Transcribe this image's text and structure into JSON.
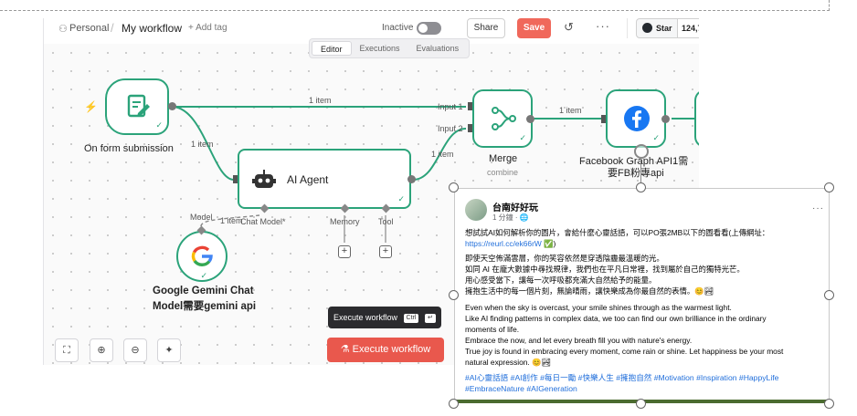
{
  "header": {
    "personal": "Personal",
    "sep": "/",
    "title": "My workflow",
    "add_tag": "+ Add tag",
    "inactive": "Inactive",
    "share": "Share",
    "save": "Save",
    "github_star": "Star",
    "github_count": "124,7"
  },
  "tabs": [
    {
      "label": "Editor",
      "active": true
    },
    {
      "label": "Executions",
      "active": false
    },
    {
      "label": "Evaluations",
      "active": false
    }
  ],
  "nodes": {
    "form": {
      "label": "On form submission"
    },
    "agent": {
      "label": "AI Agent",
      "chat_model": "Chat Model*",
      "memory": "Memory",
      "tool": "Tool"
    },
    "merge": {
      "label": "Merge",
      "sub": "combine",
      "input1": "Input 1",
      "input2": "Input 2"
    },
    "facebook": {
      "label_line1": "Facebook Graph API1需",
      "label_line2": "要FB粉專api"
    },
    "gemini": {
      "label_line1": "Google Gemini Chat",
      "label_line2": "Model需要gemini api",
      "model": "Model"
    }
  },
  "edges": {
    "form_merge": "1 item",
    "form_agent": "1 item",
    "agent_merge": "1 item",
    "merge_fb": "1 item",
    "gemini_agent": "1 item"
  },
  "controls": {
    "fit": "⛶",
    "zoom_in": "⊕",
    "zoom_out": "⊖",
    "tidy": "✦"
  },
  "tooltip": {
    "text": "Execute workflow",
    "kbd1": "Ctrl",
    "kbd2": "↵"
  },
  "execute_button": "⚗ Execute workflow",
  "fb_post": {
    "page_name": "台南好好玩",
    "time": "1 分鐘 · ",
    "line1": "想試試AI如何解析你的圖片，會給什麼心靈話語，可以PO張2MB以下的圖看看(上傳網址：",
    "link": "https://reurl.cc/ek66rW",
    "link_suffix": " ✅)",
    "zh_lines": [
      "即使天空佈滿雲層，你的笑容依然是穿透陰霾最溫暖的光。",
      "如同 AI 在龐大數據中尋找規律，我們也在平凡日常裡，找到屬於自己的獨特光芒。",
      "用心感受當下，讓每一次呼吸都充滿大自然給予的能量。",
      "擁抱生活中的每一個片刻，無論晴雨，讓快樂成為你最自然的表情。😊🏞"
    ],
    "en_lines": [
      "Even when the sky is overcast, your smile shines through as the warmest light.",
      "Like AI finding patterns in complex data, we too can find our own brilliance in the ordinary",
      "moments of life.",
      "Embrace the now, and let every breath fill you with nature's energy.",
      "True joy is found in embracing every moment, come rain or shine. Let happiness be your most",
      "natural expression. 😊🏞"
    ],
    "tags_line1": "#AI心靈話語 #AI創作 #每日一勵 #快樂人生 #擁抱自然 #Motivation #Inspiration #HappyLife",
    "tags_line2": "#EmbraceNature #AIGeneration"
  },
  "colors": {
    "node_border": "#2ba37a",
    "save": "#f0685b",
    "execute": "#e9584d",
    "facebook": "#1877f2",
    "link": "#216fdb"
  }
}
